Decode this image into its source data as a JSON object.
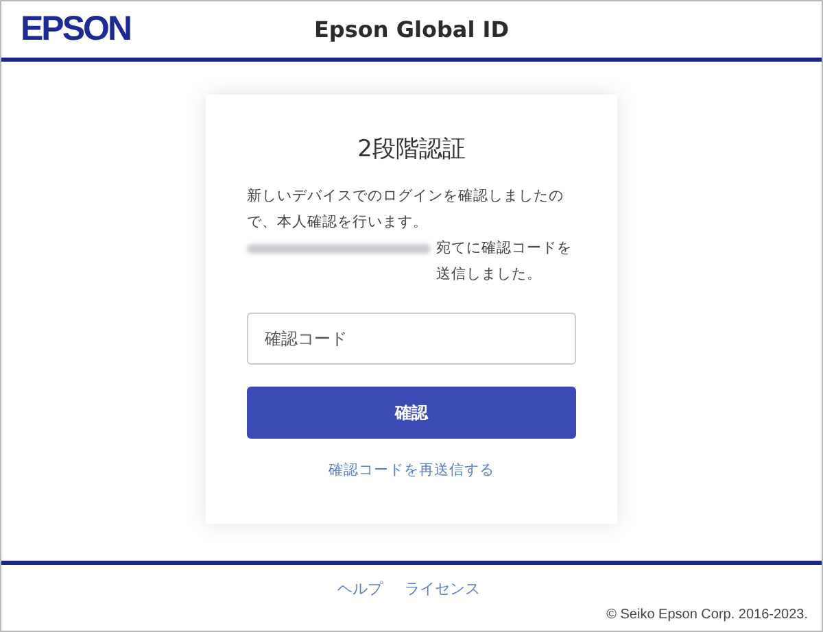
{
  "header": {
    "logo": "EPSON",
    "title": "Epson Global ID"
  },
  "card": {
    "heading": "2段階認証",
    "message": "新しいデバイスでのログインを確認しましたので、本人確認を行います。",
    "sent_notice": "宛てに確認コードを送信しました。",
    "code_field": {
      "placeholder": "確認コード"
    },
    "submit_button": "確認",
    "resend_link": "確認コードを再送信する"
  },
  "footer": {
    "links": [
      "ヘルプ",
      "ライセンス"
    ],
    "copyright": "© Seiko Epson Corp. 2016-2023."
  }
}
